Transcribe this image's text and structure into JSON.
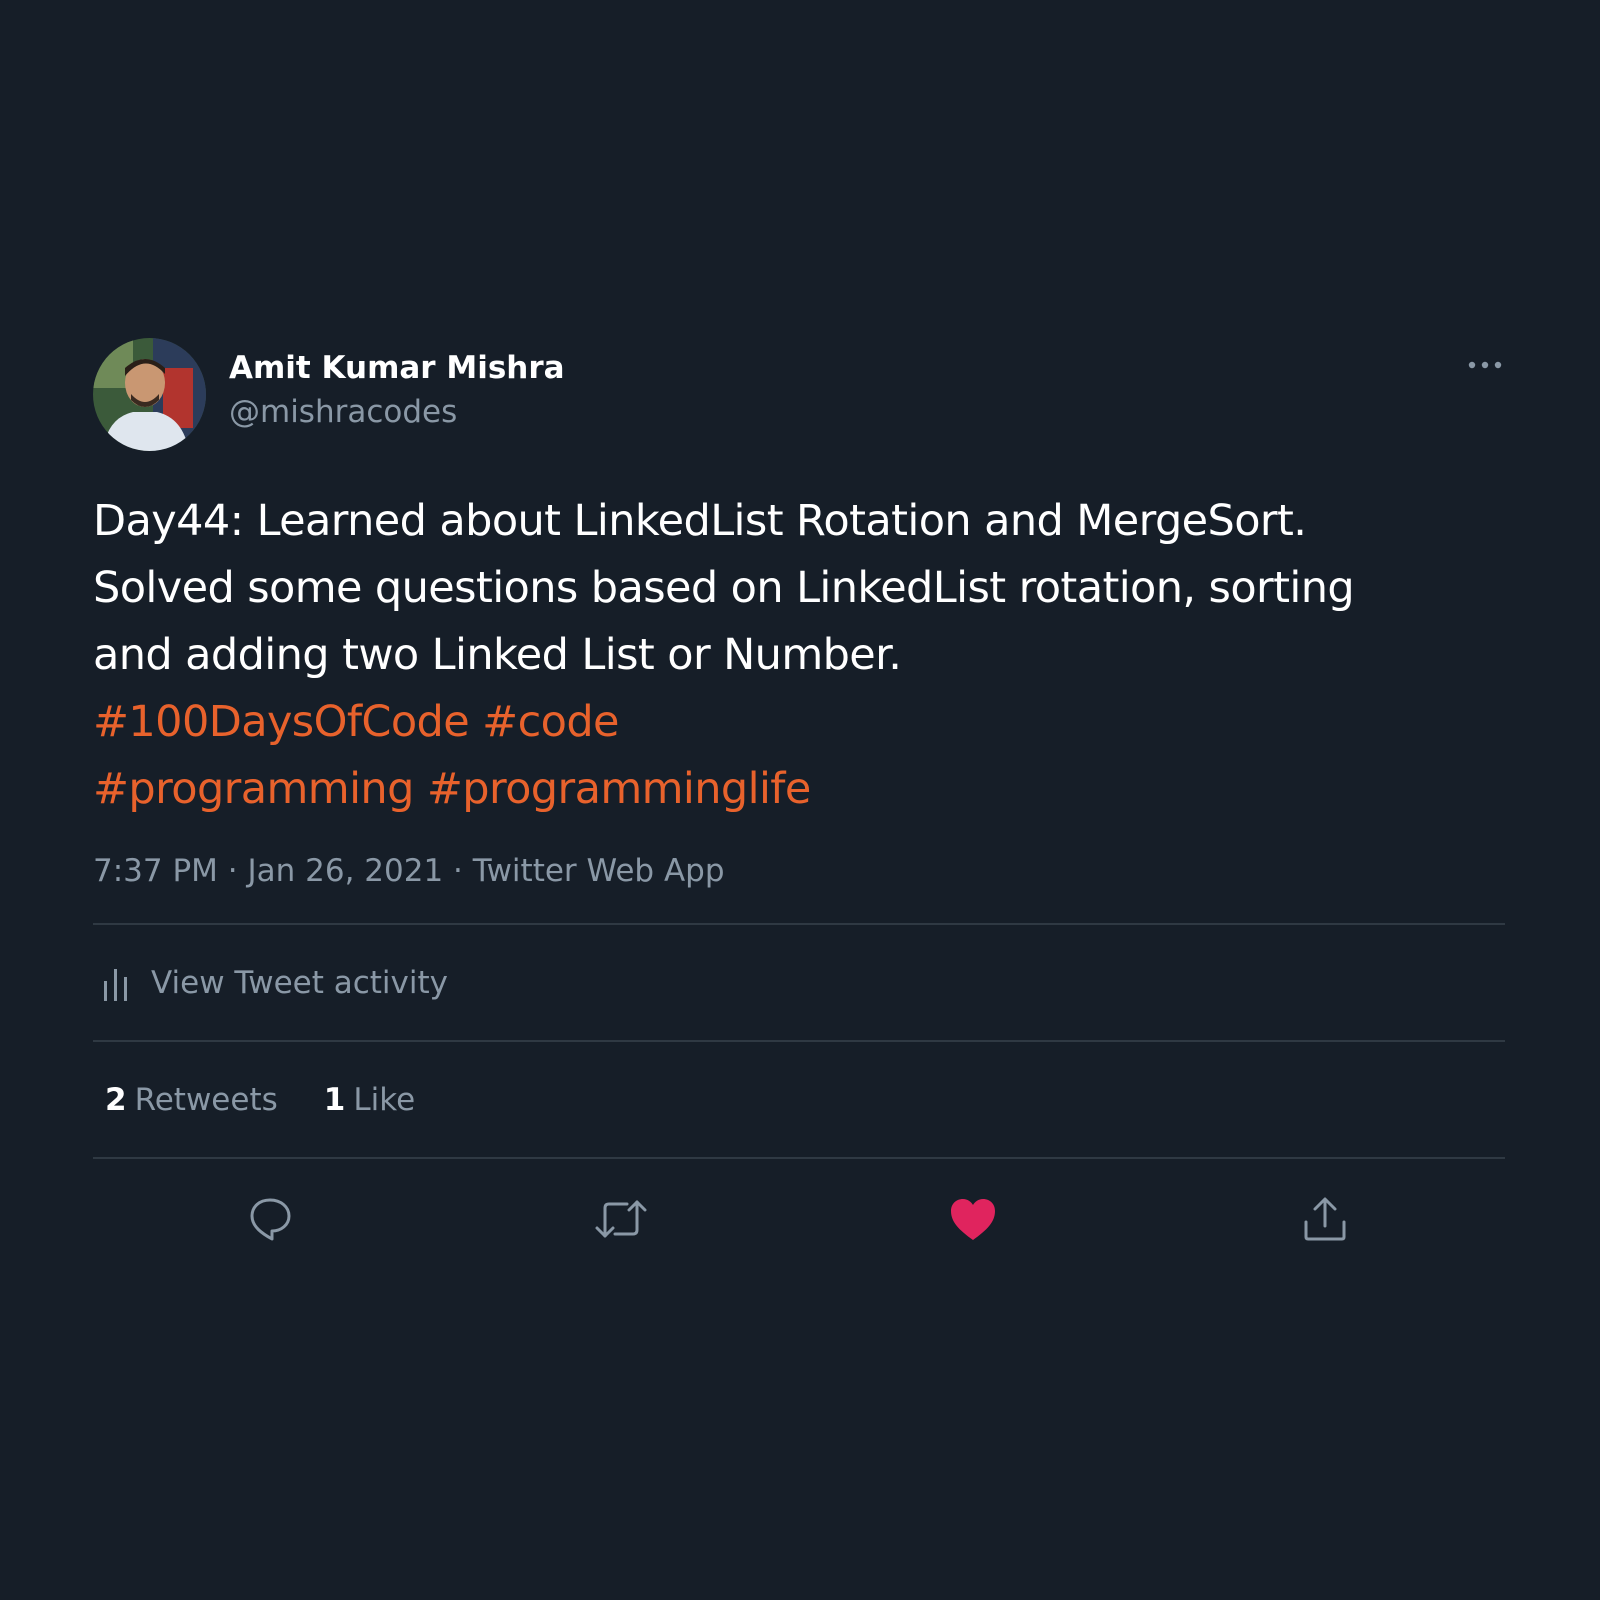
{
  "author": {
    "name": "Amit Kumar Mishra",
    "handle": "@mishracodes"
  },
  "tweet": {
    "lines": [
      "Day44: Learned about LinkedList Rotation and MergeSort.",
      "Solved some questions based on LinkedList rotation, sorting",
      "and adding two Linked List or Number."
    ],
    "hashtags": [
      "#100DaysOfCode",
      "#code",
      "#programming",
      "#programminglife"
    ],
    "time": "7:37 PM",
    "date": "Jan 26, 2021",
    "source": "Twitter Web App"
  },
  "activity": {
    "label": "View Tweet activity"
  },
  "stats": {
    "retweets_count": "2",
    "retweets_label": "Retweets",
    "likes_count": "1",
    "likes_label": "Like"
  },
  "icons": {
    "more": "more-horizontal-icon",
    "activity": "bar-chart-icon",
    "reply": "reply-icon",
    "retweet": "retweet-icon",
    "like": "heart-icon",
    "share": "share-icon"
  },
  "colors": {
    "background": "#161e28",
    "hashtag": "#e8622c",
    "like_active": "#e0245e",
    "secondary_text": "#8a98a6",
    "divider": "#2f3943"
  }
}
